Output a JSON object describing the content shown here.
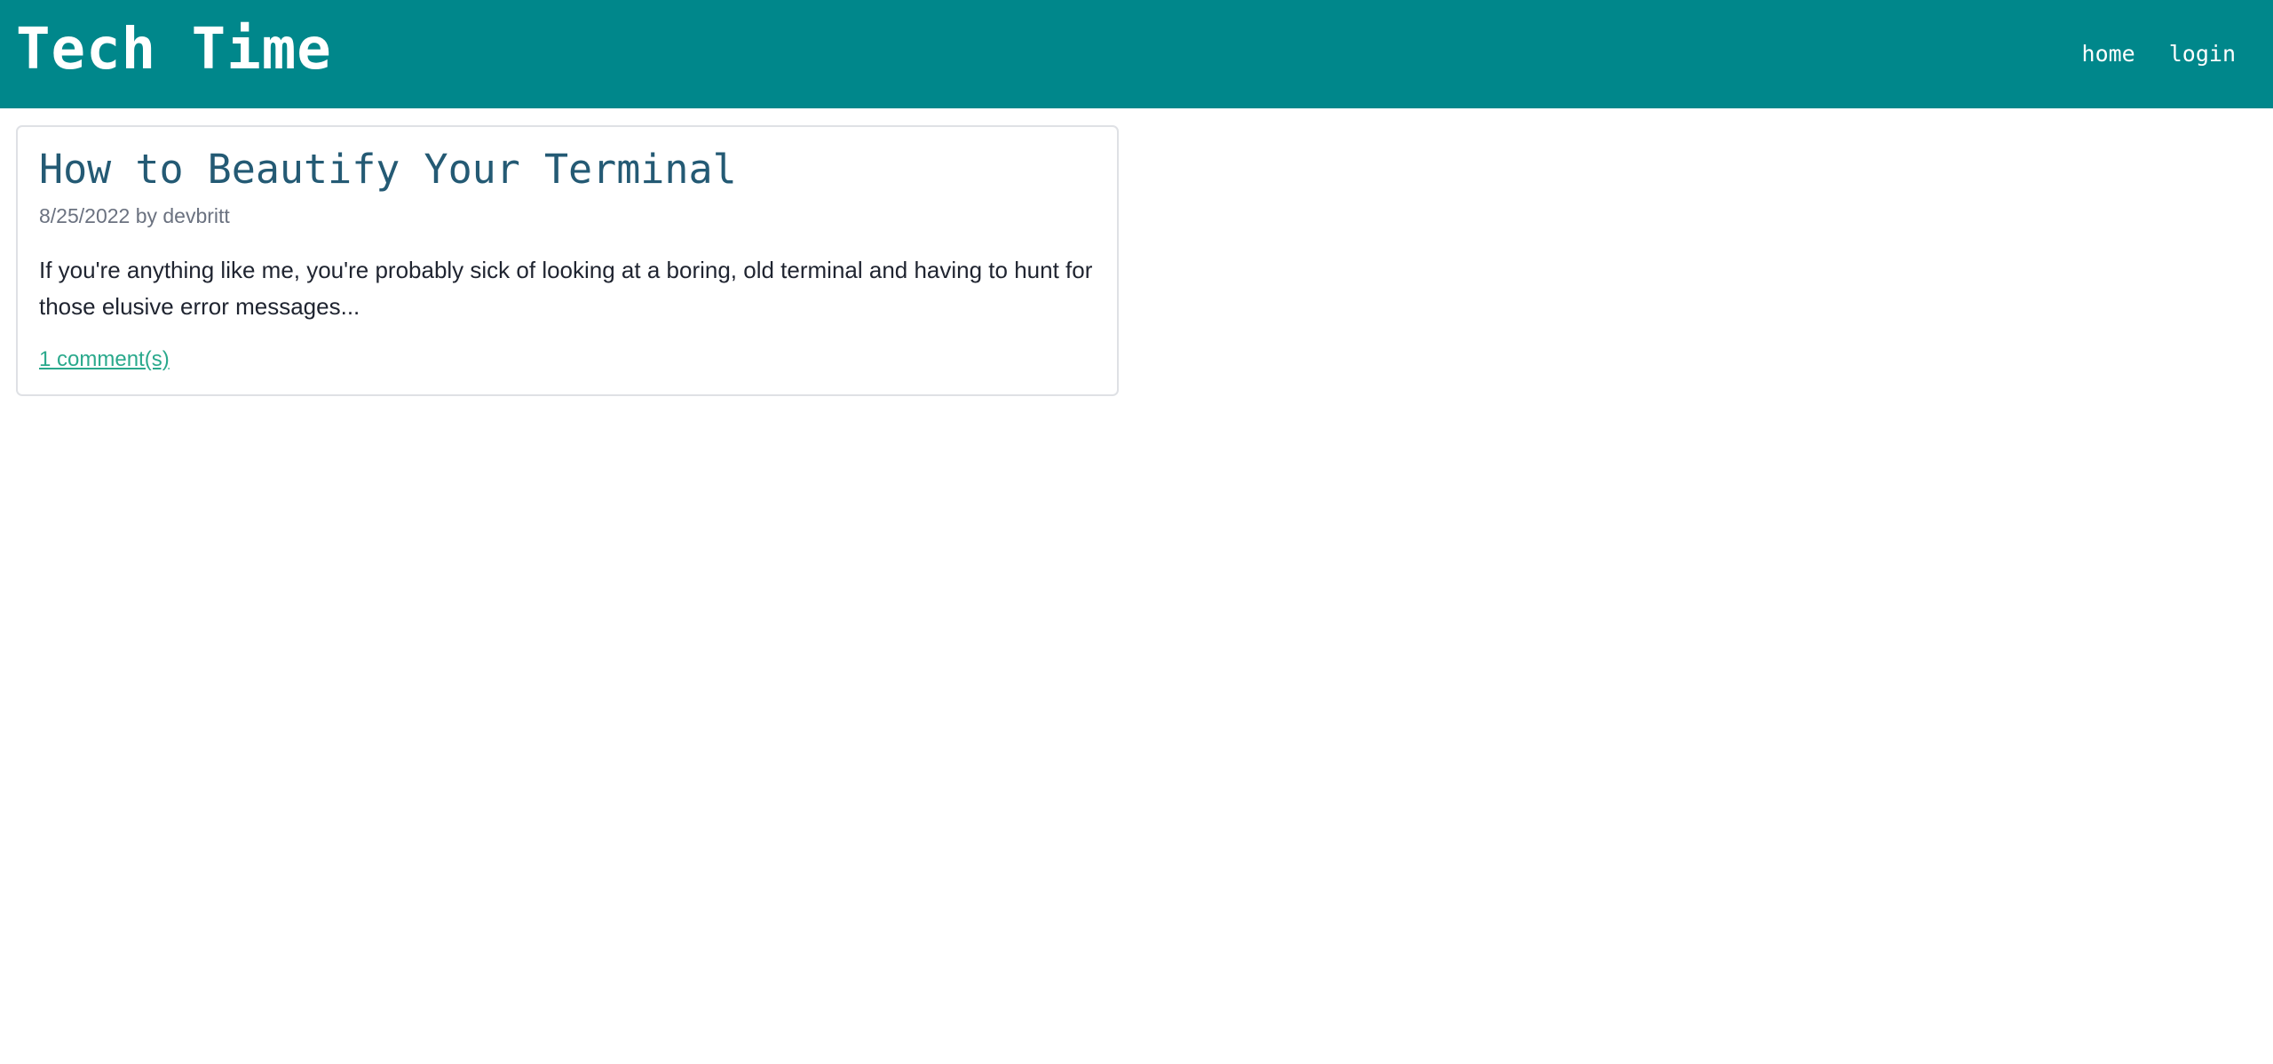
{
  "header": {
    "site_title": "Tech Time",
    "nav": {
      "home": "home",
      "login": "login"
    },
    "background_color": "#00878b"
  },
  "posts": [
    {
      "title": "How to Beautify Your Terminal",
      "meta": "8/25/2022 by devbritt",
      "excerpt": "If you're anything like me, you're probably sick of looking at a boring, old terminal and having to hunt for those elusive error messages...",
      "comments": "1 comment(s)"
    }
  ],
  "colors": {
    "title": "#245a74",
    "link": "#2aa98c",
    "meta": "#6b7280",
    "body_text": "#1f2430"
  }
}
